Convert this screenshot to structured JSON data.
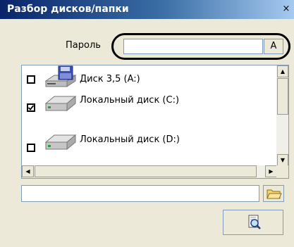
{
  "window": {
    "title": "Разбор дисков/папки",
    "close_glyph": "×"
  },
  "password": {
    "label": "Пароль",
    "value": "",
    "keyboard_button_label": "A"
  },
  "drives": [
    {
      "label": "Диск 3,5 (A:)",
      "checked": false,
      "icon": "floppy-drive-icon"
    },
    {
      "label": "Локальный диск (C:)",
      "checked": true,
      "icon": "hard-drive-icon"
    },
    {
      "label": "Локальный диск (D:)",
      "checked": false,
      "icon": "hard-drive-icon"
    }
  ],
  "path": {
    "value": ""
  },
  "icons": {
    "browse": "folder-icon",
    "search": "magnifier-icon"
  }
}
